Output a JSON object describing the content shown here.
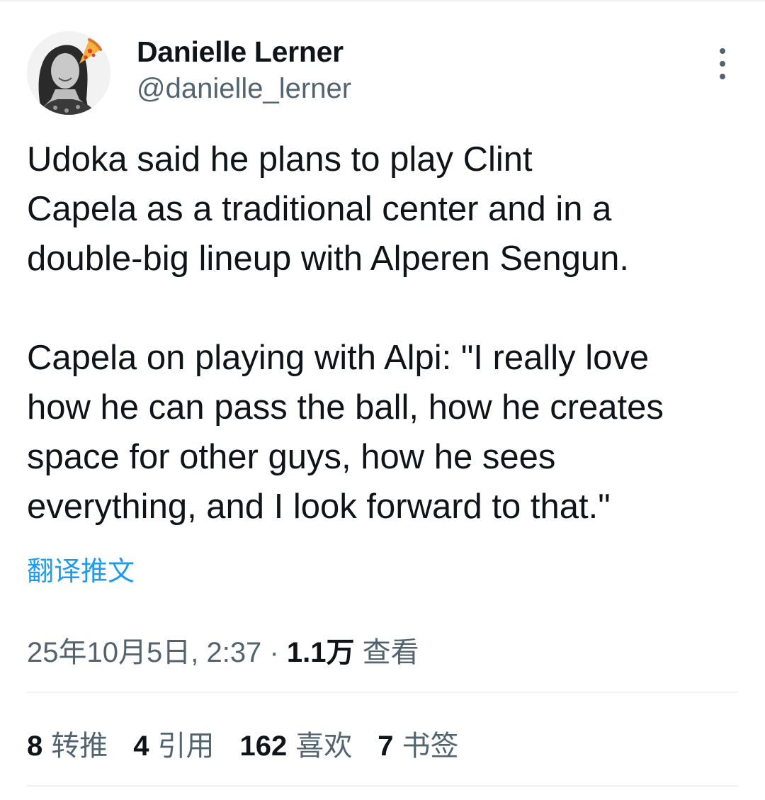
{
  "author": {
    "name": "Danielle Lerner",
    "handle": "@danielle_lerner"
  },
  "tweet": {
    "paragraphs": [
      "Udoka said he plans to play Clint\nCapela as a traditional center and in a\ndouble-big lineup with Alperen Sengun.",
      "Capela on playing with Alpi: \"I really love\nhow he can pass the ball, how he creates\nspace for other guys, how he sees\neverything, and I look forward to that.\""
    ],
    "translate_label": "翻译推文"
  },
  "meta": {
    "timestamp": "25年10月5日, 2:37",
    "separator": "·",
    "views_count": "1.1万",
    "views_label": "查看"
  },
  "stats": [
    {
      "count": "8",
      "label": "转推"
    },
    {
      "count": "4",
      "label": "引用"
    },
    {
      "count": "162",
      "label": "喜欢"
    },
    {
      "count": "7",
      "label": "书签"
    }
  ],
  "icons": {
    "avatar": "avatar-photo",
    "more": "more-vertical-icon",
    "emoji": "pizza-icon"
  },
  "colors": {
    "text": "#0f1419",
    "secondary": "#536471",
    "link": "#1d9bf0",
    "divider": "#eff3f4"
  }
}
